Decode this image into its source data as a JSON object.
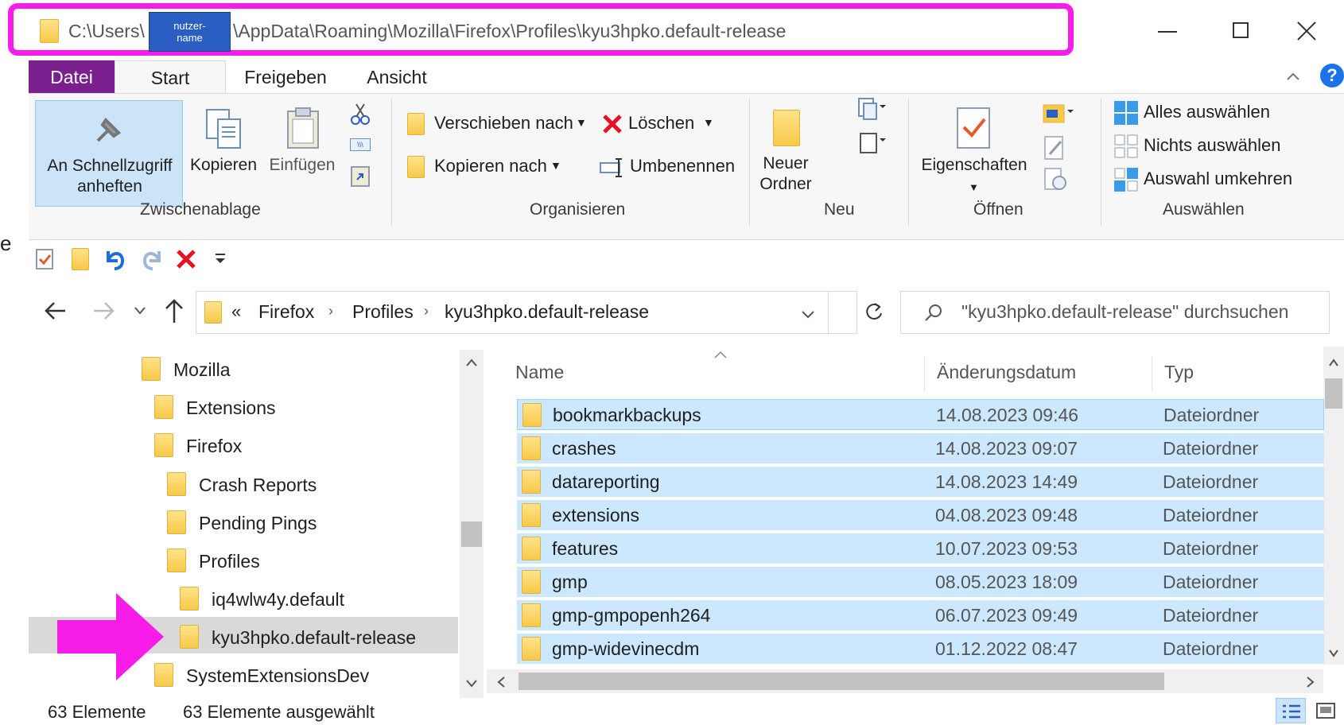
{
  "title_bar": {
    "path_prefix": "C:\\Users\\",
    "redacted_user": "nutzer-\nname",
    "path_suffix": "\\AppData\\Roaming\\Mozilla\\Firefox\\Profiles\\kyu3hpko.default-release",
    "highlight_color": "#f81ce8"
  },
  "left_edge_text": "e",
  "ribbon": {
    "tabs": [
      "Datei",
      "Start",
      "Freigeben",
      "Ansicht"
    ],
    "active_tab": "Datei",
    "datei_color": "#7b1f8f",
    "groups": {
      "clipboard": {
        "label": "Zwischenablage",
        "pin_label_1": "An Schnellzugriff",
        "pin_label_2": "anheften",
        "copy": "Kopieren",
        "paste": "Einfügen"
      },
      "organize": {
        "label": "Organisieren",
        "move_to": "Verschieben nach",
        "copy_to": "Kopieren nach",
        "delete": "Löschen",
        "rename": "Umbenennen"
      },
      "new": {
        "label": "Neu",
        "new_folder_1": "Neuer",
        "new_folder_2": "Ordner"
      },
      "open": {
        "label": "Öffnen",
        "properties": "Eigenschaften"
      },
      "select": {
        "label": "Auswählen",
        "select_all": "Alles auswählen",
        "select_none": "Nichts auswählen",
        "invert": "Auswahl umkehren"
      }
    }
  },
  "address_bar": {
    "overflow": "«",
    "crumbs": [
      "Firefox",
      "Profiles",
      "kyu3hpko.default-release"
    ],
    "search_placeholder": "\"kyu3hpko.default-release\" durchsuchen"
  },
  "tree": [
    {
      "label": "Mozilla",
      "indent": 0
    },
    {
      "label": "Extensions",
      "indent": 1
    },
    {
      "label": "Firefox",
      "indent": 1
    },
    {
      "label": "Crash Reports",
      "indent": 2
    },
    {
      "label": "Pending Pings",
      "indent": 2
    },
    {
      "label": "Profiles",
      "indent": 2
    },
    {
      "label": "iq4wlw4y.default",
      "indent": 3
    },
    {
      "label": "kyu3hpko.default-release",
      "indent": 3,
      "selected": true
    },
    {
      "label": "SystemExtensionsDev",
      "indent": 1
    }
  ],
  "file_list": {
    "columns": [
      "Name",
      "Änderungsdatum",
      "Typ"
    ],
    "rows": [
      {
        "name": "bookmarkbackups",
        "date": "14.08.2023 09:46",
        "type": "Dateiordner"
      },
      {
        "name": "crashes",
        "date": "14.08.2023 09:07",
        "type": "Dateiordner"
      },
      {
        "name": "datareporting",
        "date": "14.08.2023 14:49",
        "type": "Dateiordner"
      },
      {
        "name": "extensions",
        "date": "04.08.2023 09:48",
        "type": "Dateiordner"
      },
      {
        "name": "features",
        "date": "10.07.2023 09:53",
        "type": "Dateiordner"
      },
      {
        "name": "gmp",
        "date": "08.05.2023 18:09",
        "type": "Dateiordner"
      },
      {
        "name": "gmp-gmpopenh264",
        "date": "06.07.2023 09:49",
        "type": "Dateiordner"
      },
      {
        "name": "gmp-widevinecdm",
        "date": "01.12.2022 08:47",
        "type": "Dateiordner"
      }
    ]
  },
  "status_bar": {
    "count": "63 Elemente",
    "selected": "63 Elemente ausgewählt"
  }
}
